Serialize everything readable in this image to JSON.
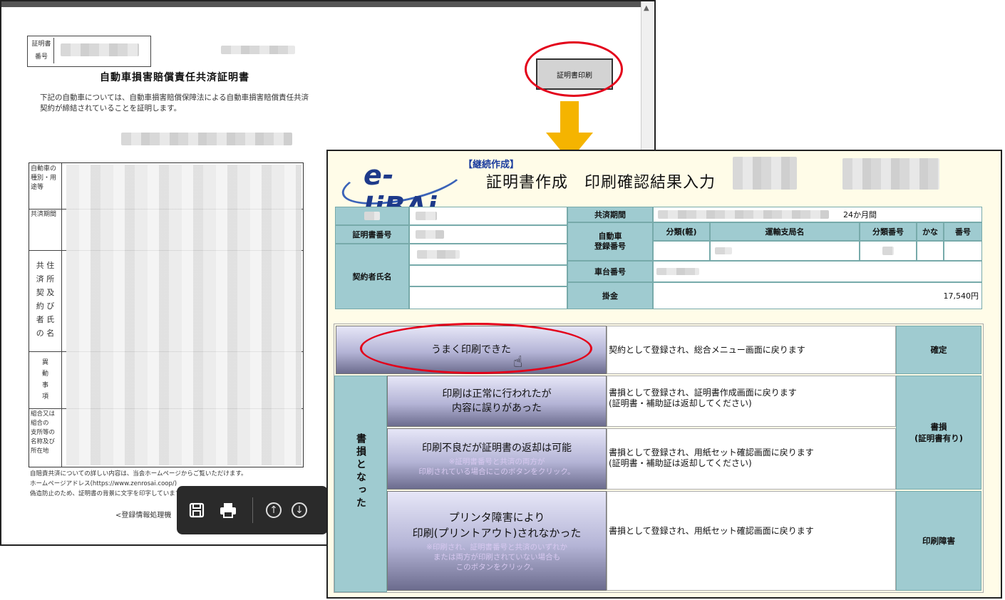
{
  "document": {
    "cert_no_label": "証明書\n番号",
    "title": "自動車損害賠償責任共済証明書",
    "description": "下記の自動車については、自動車損害賠償保障法による自動車損害賠償責任共済契約が締結されていることを証明します。",
    "print_button": "証明書印刷",
    "row_labels": [
      "自動車の種別・用途等",
      "共済期間",
      "共 住\n済 所\n契 及\n約 び\n者 氏\nの 名",
      "異\n動\n事\n項",
      "組合又は\n組合の\n支所等の\n名称及び\n所在地"
    ],
    "footer_lines": [
      "自賠責共済についての詳しい内容は、当会ホームページからご覧いただけます。",
      "ホームページアドレス(https://www.zenrosai.coop/)",
      "偽造防止のため、証明書の背景に文字を印字しています。"
    ],
    "footer2": "<登録情報処理機"
  },
  "main": {
    "logo": "e-JiBAi",
    "mode": "【継続作成】",
    "title": "証明書作成　印刷確認結果入力",
    "info": {
      "label_top_left": "",
      "cert_no_label": "証明書番号",
      "contractor_label": "契約者氏名",
      "period_label": "共済期間",
      "period_value": "24か月間",
      "plate_label": "自動車\n登録番号",
      "plate_headers": [
        "分類(軽)",
        "運輸支局名",
        "分類番号",
        "かな",
        "番号"
      ],
      "chassis_label": "車台番号",
      "premium_label": "掛金",
      "premium_value": "17,540円"
    },
    "actions": {
      "ok": {
        "label": "うまく印刷できた",
        "desc": "契約として登録され、総合メニュー画面に戻ります",
        "result": "確定"
      },
      "void_group": "書損となった",
      "content_error": {
        "label": "印刷は正常に行われたが\n内容に誤りがあった",
        "desc": "書損として登録され、証明書作成画面に戻ります\n(証明書・補助証は返却してください)"
      },
      "poor_print": {
        "label": "印刷不良だが証明書の返却は可能",
        "note": "※証明書番号と共済の両方が\n印刷されている場合にこのボタンをクリック。",
        "desc": "書損として登録され、用紙セット確認画面に戻ります\n(証明書・補助証は返却してください)"
      },
      "void_result": "書損\n(証明書有り)",
      "printer_fail": {
        "label": "プリンタ障害により\n印刷(プリントアウト)されなかった",
        "note": "※印刷され、証明書番号と共済のいずれか\nまたは両方が印刷されていない場合も\nこのボタンをクリック。",
        "desc": "書損として登録され、用紙セット確認画面に戻ります",
        "result": "印刷障害"
      }
    }
  },
  "colors": {
    "highlight": "#e3001a",
    "arrow": "#f5b400",
    "label_bg": "#9fcbd0",
    "panel_bg": "#fffce8"
  }
}
